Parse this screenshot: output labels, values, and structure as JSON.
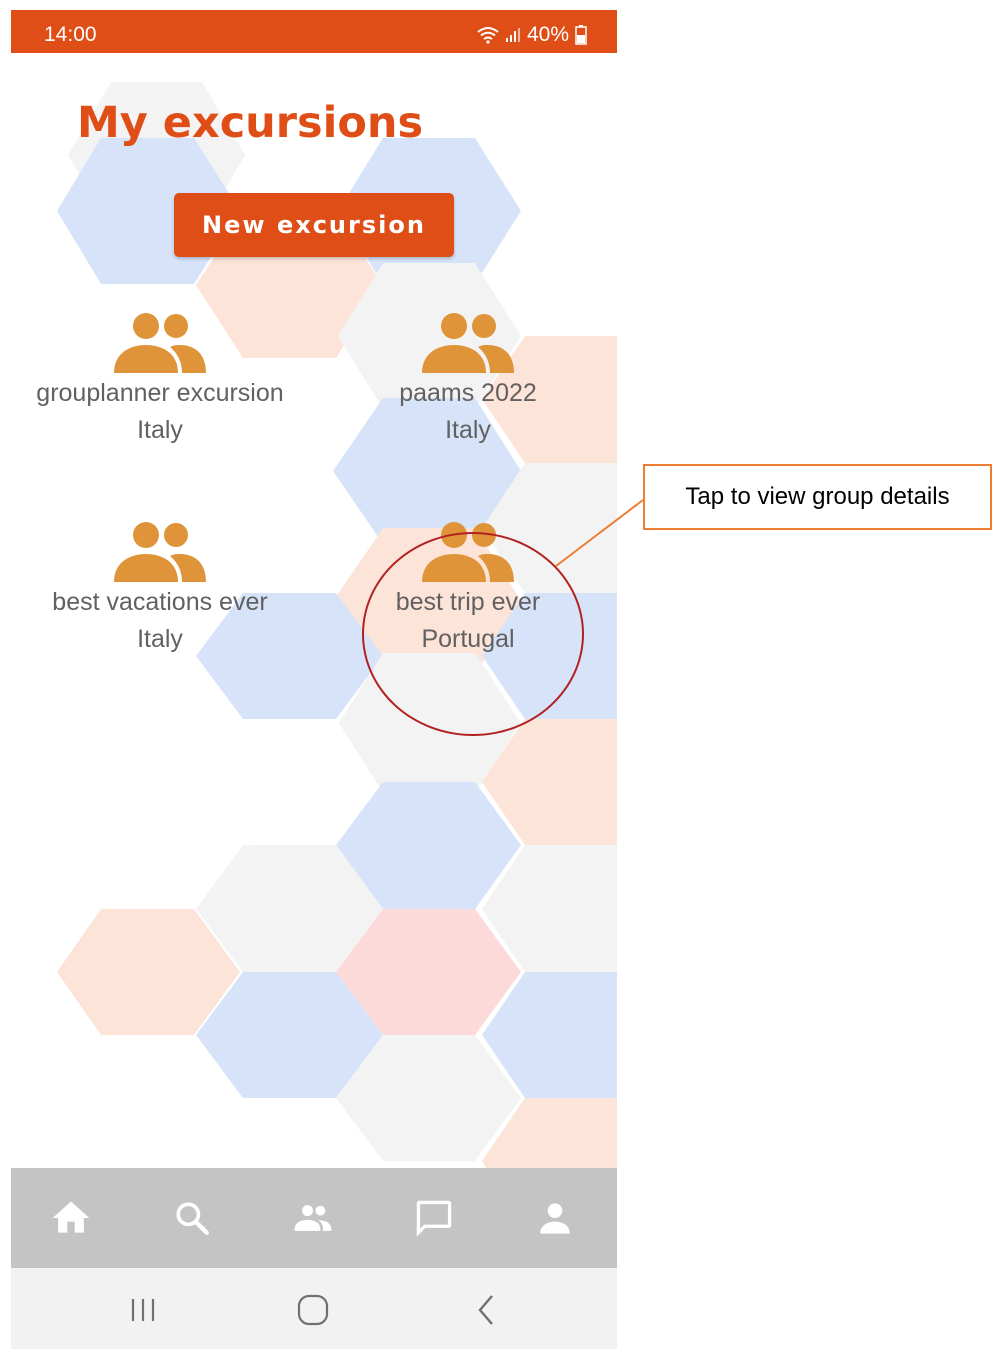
{
  "status_bar": {
    "time": "14:00",
    "battery": "40%",
    "icons": [
      "wifi-icon",
      "signal-icon",
      "battery-icon"
    ]
  },
  "page": {
    "title": "My excursions",
    "new_button_label": "New excursion"
  },
  "groups": [
    {
      "name": "grouplanner excursion",
      "country": "Italy",
      "icon": "group-icon"
    },
    {
      "name": "paams 2022",
      "country": "Italy",
      "icon": "group-icon"
    },
    {
      "name": "best vacations ever",
      "country": "Italy",
      "icon": "group-icon"
    },
    {
      "name": "best trip ever",
      "country": "Portugal",
      "icon": "group-icon"
    }
  ],
  "bottom_nav": {
    "items": [
      "home-icon",
      "search-icon",
      "groups-icon",
      "chat-icon",
      "profile-icon"
    ]
  },
  "system_nav": {
    "items": [
      "recent-apps-icon",
      "home-circle-icon",
      "back-icon"
    ]
  },
  "annotation": {
    "callout_text": "Tap to view group details"
  },
  "colors": {
    "brand": "#e04e17",
    "group_icon": "#e0943a",
    "text": "#616161",
    "nav_bar": "#c4c4c4",
    "hex_blue": "#d5e2f9",
    "hex_peach": "#fde3d7",
    "hex_gray": "#f3f3f3",
    "hex_pink": "#fcd9d9",
    "annotation_circle": "#b22222",
    "annotation_box": "#ed7d31"
  }
}
